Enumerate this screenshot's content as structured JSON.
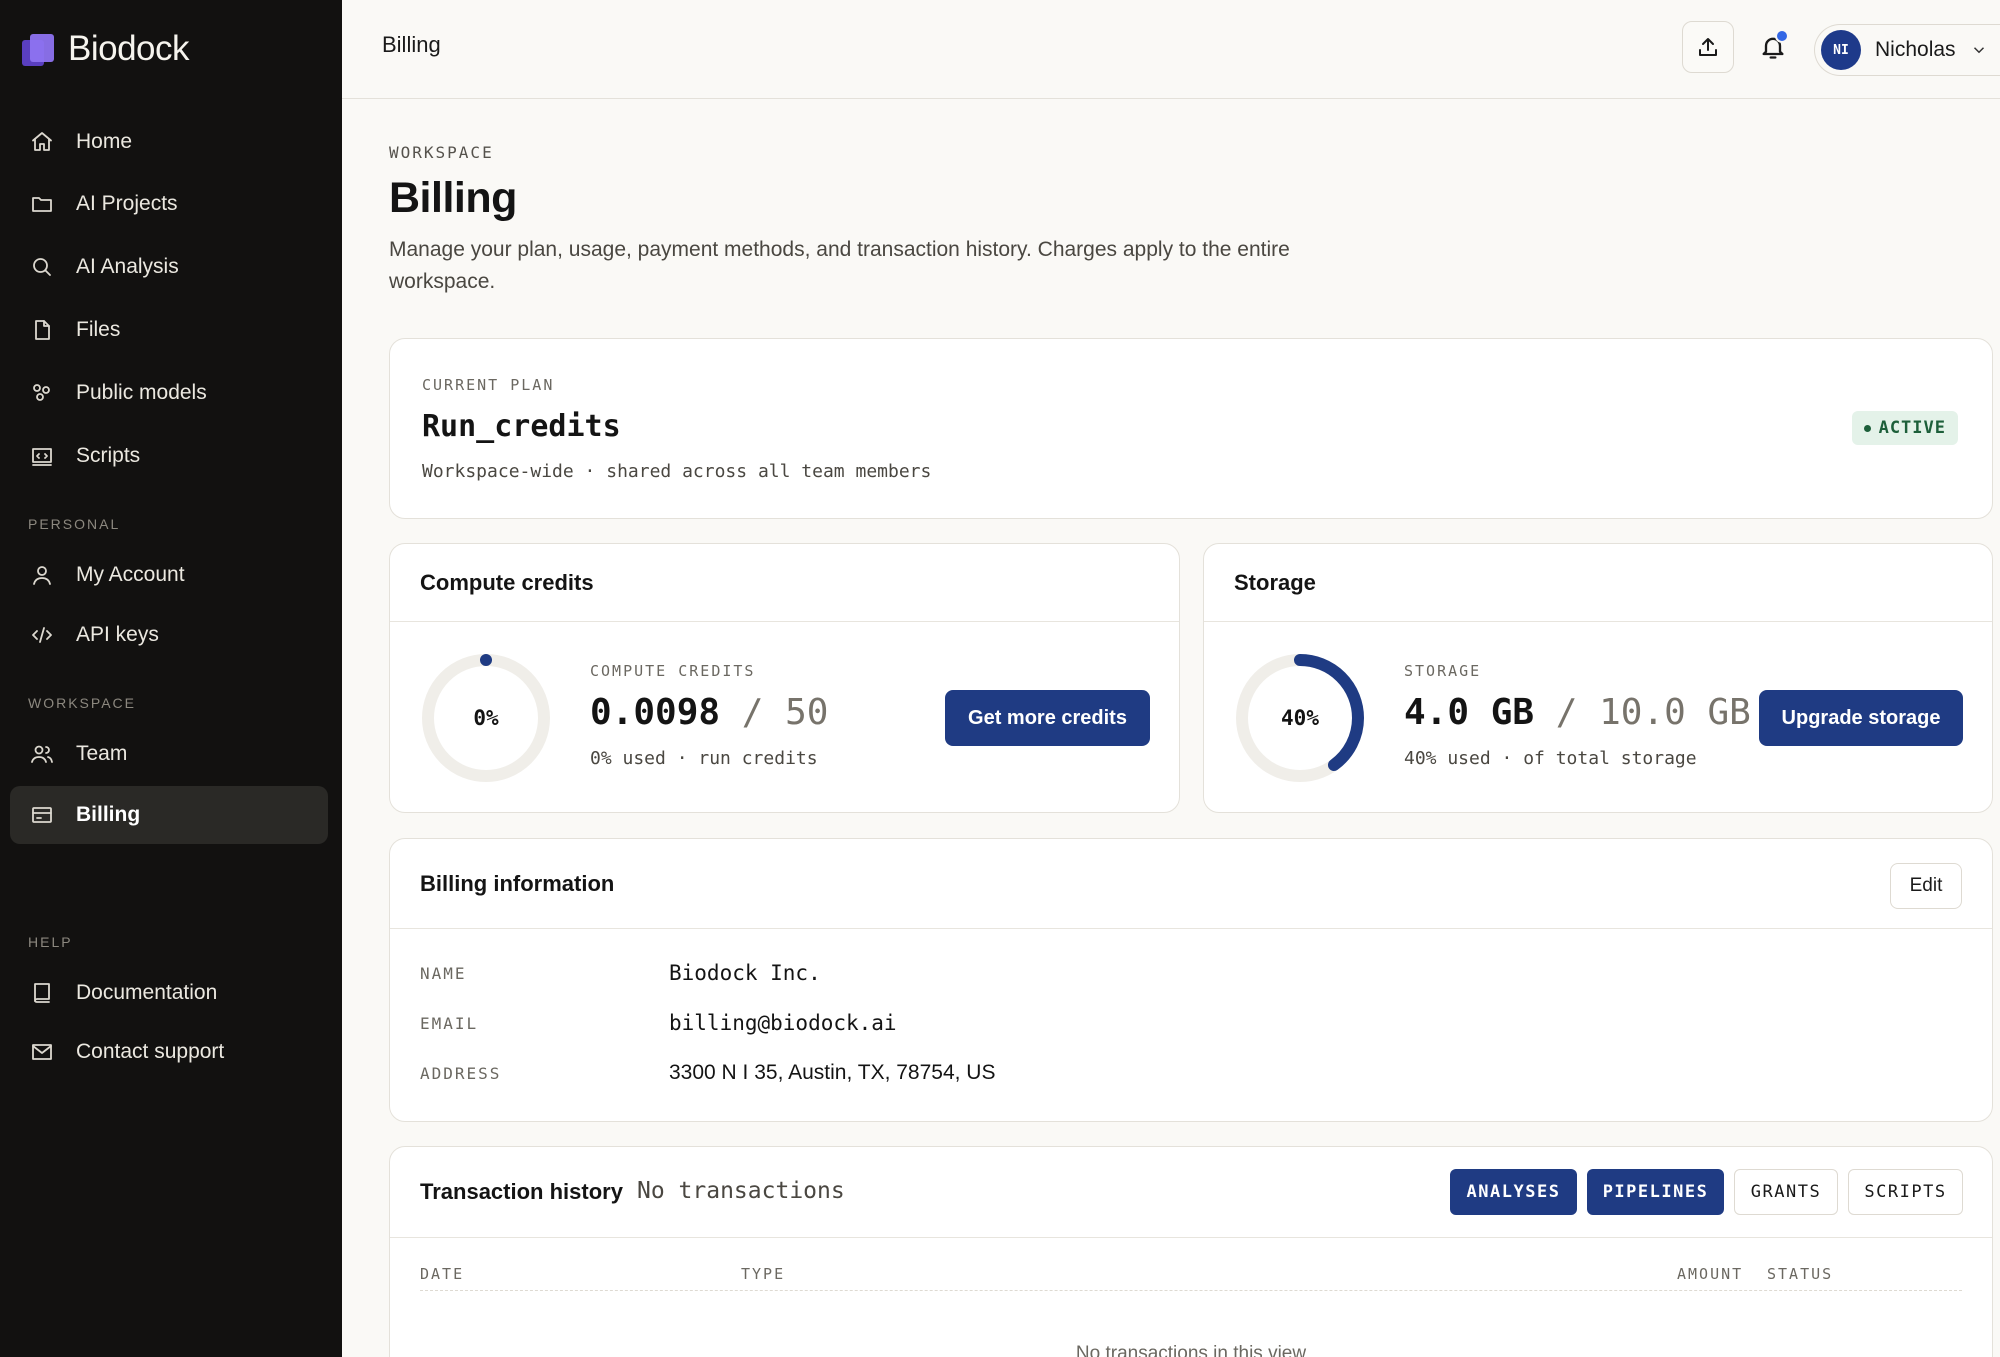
{
  "brand": {
    "name": "Biodock"
  },
  "sidebar": {
    "main": [
      {
        "label": "Home",
        "icon": "home-icon"
      },
      {
        "label": "AI Projects",
        "icon": "folder-icon"
      },
      {
        "label": "AI Analysis",
        "icon": "search-icon"
      },
      {
        "label": "Files",
        "icon": "file-icon"
      },
      {
        "label": "Public models",
        "icon": "models-icon"
      },
      {
        "label": "Scripts",
        "icon": "scripts-icon"
      }
    ],
    "personal_heading": "PERSONAL",
    "personal": [
      {
        "label": "My Account",
        "icon": "user-icon"
      },
      {
        "label": "API keys",
        "icon": "code-icon"
      }
    ],
    "workspace_heading": "WORKSPACE",
    "workspace": [
      {
        "label": "Team",
        "icon": "team-icon"
      },
      {
        "label": "Billing",
        "icon": "card-icon",
        "active": true
      }
    ],
    "help_heading": "HELP",
    "help": [
      {
        "label": "Documentation",
        "icon": "book-icon"
      },
      {
        "label": "Contact support",
        "icon": "mail-icon"
      }
    ]
  },
  "header": {
    "title": "Billing",
    "user": {
      "initials": "NI",
      "name": "Nicholas"
    },
    "accent": "#3367e5"
  },
  "page": {
    "eyebrow": "WORKSPACE",
    "title": "Billing",
    "description": "Manage your plan, usage, payment methods, and transaction history. Charges apply to the entire workspace."
  },
  "plan": {
    "label": "CURRENT PLAN",
    "name": "Run_credits",
    "subtitle": "Workspace-wide · shared across all team members",
    "status": "ACTIVE",
    "status_color": "#1d5f3a"
  },
  "compute": {
    "title": "Compute credits",
    "percent": 0,
    "percent_label": "0%",
    "label": "COMPUTE CREDITS",
    "used": "0.0098",
    "separator": "/",
    "total": "50",
    "sub": "0% used · run credits",
    "button": "Get more credits"
  },
  "storage": {
    "title": "Storage",
    "percent": 40,
    "percent_label": "40%",
    "label": "STORAGE",
    "used": "4.0 GB",
    "separator": "/",
    "total": "10.0 GB",
    "sub": "40% used · of total storage",
    "button": "Upgrade storage"
  },
  "billing_info": {
    "title": "Billing information",
    "edit": "Edit",
    "rows": [
      {
        "key": "NAME",
        "value": "Biodock Inc."
      },
      {
        "key": "EMAIL",
        "value": "billing@biodock.ai"
      },
      {
        "key": "ADDRESS",
        "value": "3300 N I 35, Austin, TX, 78754, US"
      }
    ]
  },
  "transactions": {
    "title": "Transaction history",
    "subtitle": "No transactions",
    "filters": [
      {
        "label": "ANALYSES",
        "on": true
      },
      {
        "label": "PIPELINES",
        "on": true
      },
      {
        "label": "GRANTS",
        "on": false
      },
      {
        "label": "SCRIPTS",
        "on": false
      }
    ],
    "columns": [
      "DATE",
      "TYPE",
      "AMOUNT",
      "STATUS"
    ],
    "empty": "No transactions in this view"
  },
  "colors": {
    "primary": "#1f3b83",
    "ring_track": "#f0eee9"
  }
}
